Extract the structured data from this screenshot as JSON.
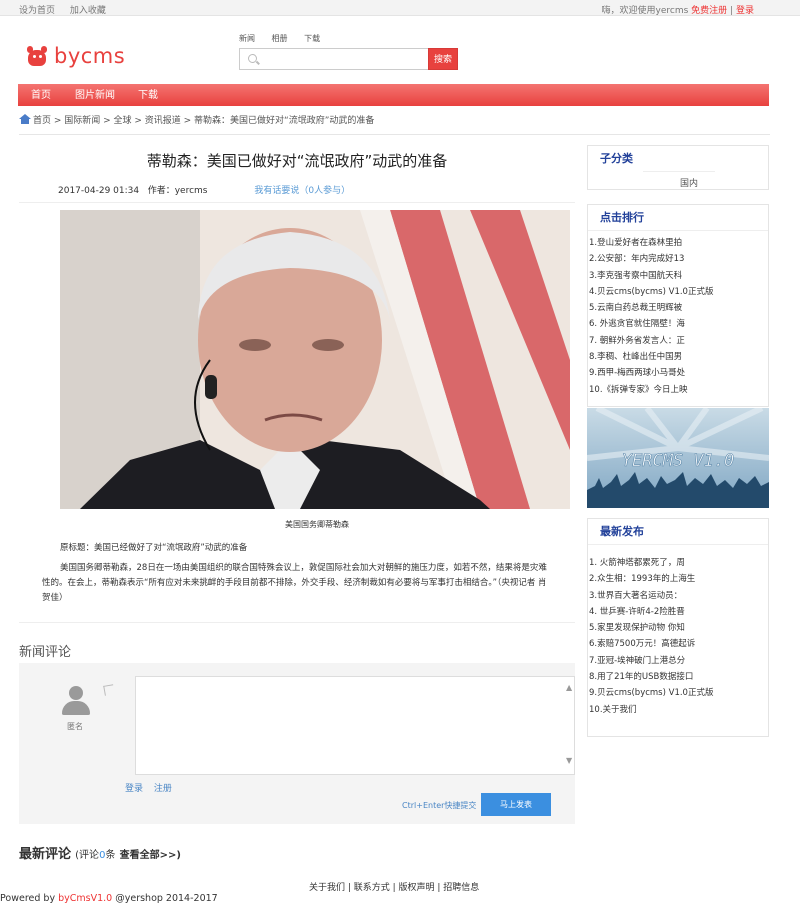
{
  "topbar": {
    "set_home": "设为首页",
    "add_fav": "加入收藏",
    "welcome": "嗨，欢迎使用yercms",
    "register": "免费注册",
    "separator": "|",
    "login": "登录"
  },
  "logo": {
    "text": "bycms"
  },
  "search": {
    "tabs": [
      "新闻",
      "相册",
      "下载"
    ],
    "placeholder": "",
    "button": "搜索"
  },
  "nav": {
    "items": [
      "首页",
      "图片新闻",
      "下载"
    ]
  },
  "breadcrumb": "首页 > 国际新闻 > 全球 > 资讯报道 > 蒂勒森：美国已做好对“流氓政府”动武的准备",
  "article": {
    "title": "蒂勒森：美国已做好对“流氓政府”动武的准备",
    "datetime": "2017-04-29 01:34",
    "author": "作者：yercms",
    "comment_link": "我有话要说（0人参与）",
    "photo_caption": "美国国务卿蒂勒森",
    "p1": "原标题：美国已经做好了对“流氓政府”动武的准备",
    "p2": "美国国务卿蒂勒森，28日在一场由美国组织的联合国特殊会议上，敦促国际社会加大对朝鲜的施压力度，如若不然，结果将是灾难性的。在会上，蒂勒森表示“所有应对未来挑衅的手段目前都不排除，外交手段、经济制裁如有必要将与军事打击相结合。”（央视记者 肖贺佳）"
  },
  "comments": {
    "title": "新闻评论",
    "anonymous": "匿名",
    "login": "登录",
    "register": "注册",
    "hint": "Ctrl+Enter快捷提交",
    "submit": "马上发表",
    "latest_title": "最新评论",
    "latest_count_prefix": "(评论",
    "latest_count": "0",
    "latest_count_suffix": "条",
    "view_all": "查看全部>>)"
  },
  "footer": {
    "links": "关于我们 | 联系方式 | 版权声明 | 招聘信息",
    "powered_prefix": "Powered by ",
    "powered_brand": "byCmsV1.0",
    "powered_suffix": " @yershop 2014-2017"
  },
  "sidebar": {
    "sub_title": "子分类",
    "sub_item": "国内",
    "rank_title": "点击排行",
    "rank_items": [
      "1.登山爱好者在森林里拍",
      "2.公安部：年内完成好13",
      "3.李克强考察中国航天科",
      "4.贝云cms(bycms) V1.0正式版",
      "5.云南白药总裁王明辉被",
      "6. 外逃贪官就住隔壁！海",
      "7. 朝鲜外务省发言人：正",
      "8.李稠、杜峰出任中国男",
      "9.西甲-梅西两球小马哥处",
      "10.《拆弹专家》今日上映"
    ],
    "banner_text": "YERCMS V1.0",
    "new_title": "最新发布",
    "new_items": [
      "1. 火箭神塔都累死了，周",
      "2.众生相：1993年的上海生",
      "3.世界百大著名运动员：",
      "4. 世乒赛-许昕4-2险胜晋",
      "5.家里发现保护动物 你知",
      "6.索赔7500万元！高德起诉",
      "7.亚冠-埃神破门上港总分",
      "8.用了21年的USB数据接口",
      "9.贝云cms(bycms) V1.0正式版",
      "10.关于我们"
    ]
  },
  "colors": {
    "brand_red": "#e8413e",
    "nav_blue": "#22419a",
    "link_blue": "#3b8fe0"
  }
}
